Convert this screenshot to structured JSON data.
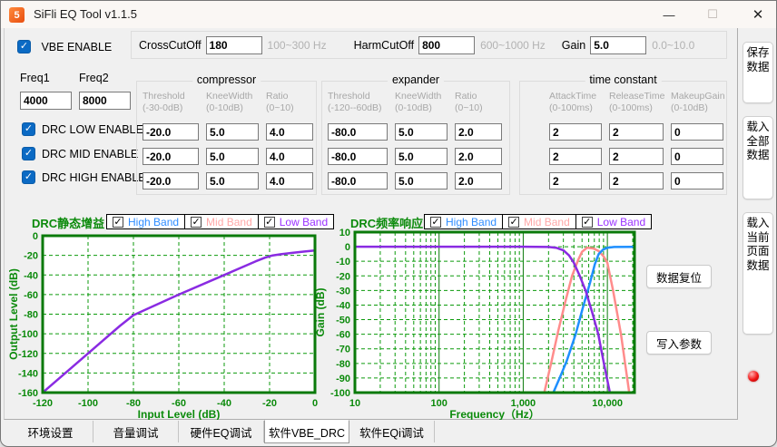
{
  "window": {
    "title": "SiFli EQ Tool v1.1.5",
    "minimize_glyph": "—",
    "maximize_glyph": "☐",
    "close_glyph": "✕",
    "logo_glyph": "5"
  },
  "vbe": {
    "enable_label": "VBE ENABLE",
    "enabled": true,
    "cross_cutoff": {
      "label": "CrossCutOff",
      "value": "180",
      "hint": "100~300 Hz"
    },
    "harm_cutoff": {
      "label": "HarmCutOff",
      "value": "800",
      "hint": "600~1000 Hz"
    },
    "gain": {
      "label": "Gain",
      "value": "5.0",
      "hint": "0.0~10.0"
    }
  },
  "freq": {
    "freq1_label": "Freq1",
    "freq1_value": "4000",
    "freq2_label": "Freq2",
    "freq2_value": "8000"
  },
  "drc": {
    "rows": [
      {
        "label": "DRC LOW ENABLE",
        "checked": true
      },
      {
        "label": "DRC MID ENABLE",
        "checked": true
      },
      {
        "label": "DRC HIGH ENABLE",
        "checked": true
      }
    ]
  },
  "groups": {
    "compressor": {
      "title": "compressor",
      "columns": [
        {
          "name": "Threshold",
          "range": "(-30-0dB)"
        },
        {
          "name": "KneeWidth",
          "range": "(0-10dB)"
        },
        {
          "name": "Ratio",
          "range": "(0~10)"
        }
      ],
      "rows": [
        [
          "-20.0",
          "5.0",
          "4.0"
        ],
        [
          "-20.0",
          "5.0",
          "4.0"
        ],
        [
          "-20.0",
          "5.0",
          "4.0"
        ]
      ]
    },
    "expander": {
      "title": "expander",
      "columns": [
        {
          "name": "Threshold",
          "range": "(-120--60dB)"
        },
        {
          "name": "KneeWidth",
          "range": "(0-10dB)"
        },
        {
          "name": "Ratio",
          "range": "(0~10)"
        }
      ],
      "rows": [
        [
          "-80.0",
          "5.0",
          "2.0"
        ],
        [
          "-80.0",
          "5.0",
          "2.0"
        ],
        [
          "-80.0",
          "5.0",
          "2.0"
        ]
      ]
    },
    "time_constant": {
      "title": "time constant",
      "columns": [
        {
          "name": "AttackTime",
          "range": "(0-100ms)"
        },
        {
          "name": "ReleaseTime",
          "range": "(0-100ms)"
        },
        {
          "name": "MakeupGain",
          "range": "(0-10dB)"
        }
      ],
      "rows": [
        [
          "2",
          "2",
          "0"
        ],
        [
          "2",
          "2",
          "0"
        ],
        [
          "2",
          "2",
          "0"
        ]
      ]
    }
  },
  "charts": {
    "legend": {
      "items": [
        {
          "label": "High Band",
          "color": "#2f8dff",
          "checked": true
        },
        {
          "label": "Mid Band",
          "color": "#ffa8a8",
          "checked": true
        },
        {
          "label": "Low Band",
          "color": "#9a30ff",
          "checked": true
        }
      ]
    },
    "accent_green": "#0b8a0b"
  },
  "chart_data": [
    {
      "type": "line",
      "id": "static_gain",
      "title": "DRC静态增益",
      "xlabel": "Input Level (dB)",
      "ylabel": "Output Level (dB)",
      "x_scale": "linear",
      "xlim": [
        -120,
        0
      ],
      "ylim": [
        -160,
        0
      ],
      "grid": true,
      "legend_position": "top",
      "x_ticks": [
        {
          "v": -120,
          "label": "-120"
        },
        {
          "v": -100,
          "label": "-100"
        },
        {
          "v": -80,
          "label": "-80"
        },
        {
          "v": -60,
          "label": "-60"
        },
        {
          "v": -40,
          "label": "-40"
        },
        {
          "v": -20,
          "label": "-20"
        },
        {
          "v": 0,
          "label": "0"
        }
      ],
      "y_ticks": [
        {
          "v": 0,
          "label": "0"
        },
        {
          "v": -20,
          "label": "-20"
        },
        {
          "v": -40,
          "label": "-40"
        },
        {
          "v": -60,
          "label": "-60"
        },
        {
          "v": -80,
          "label": "-80"
        },
        {
          "v": -100,
          "label": "-100"
        },
        {
          "v": -120,
          "label": "-120"
        },
        {
          "v": -140,
          "label": "-140"
        },
        {
          "v": -160,
          "label": "-160"
        }
      ],
      "series": [
        {
          "name": "all-bands-static-gain",
          "color": "#8a2be2",
          "points": [
            [
              -120,
              -160
            ],
            [
              -100,
              -120
            ],
            [
              -86,
              -92
            ],
            [
              -80,
              -81
            ],
            [
              -74,
              -74.6
            ],
            [
              -60,
              -60
            ],
            [
              -40,
              -40
            ],
            [
              -26,
              -26
            ],
            [
              -22,
              -22.4
            ],
            [
              -19,
              -20.3
            ],
            [
              -15,
              -18.9
            ],
            [
              -10,
              -17.5
            ],
            [
              -5,
              -16.2
            ],
            [
              0,
              -15
            ]
          ]
        }
      ]
    },
    {
      "type": "line",
      "id": "freq_response",
      "title": "DRC频率响应",
      "xlabel": "Frequency（Hz）",
      "ylabel": "Gain (dB)",
      "x_scale": "log",
      "xlim": [
        10,
        21000
      ],
      "ylim": [
        -100,
        10
      ],
      "grid": true,
      "legend_position": "top",
      "x_ticks": [
        {
          "v": 10,
          "label": "10"
        },
        {
          "v": 100,
          "label": "100"
        },
        {
          "v": 1000,
          "label": "1,000"
        },
        {
          "v": 10000,
          "label": "10,000"
        }
      ],
      "y_ticks": [
        {
          "v": 10,
          "label": "10"
        },
        {
          "v": 0,
          "label": "0"
        },
        {
          "v": -10,
          "label": "-10"
        },
        {
          "v": -20,
          "label": "-20"
        },
        {
          "v": -30,
          "label": "-30"
        },
        {
          "v": -40,
          "label": "-40"
        },
        {
          "v": -50,
          "label": "-50"
        },
        {
          "v": -60,
          "label": "-60"
        },
        {
          "v": -70,
          "label": "-70"
        },
        {
          "v": -80,
          "label": "-80"
        },
        {
          "v": -90,
          "label": "-90"
        },
        {
          "v": -100,
          "label": "-100"
        }
      ],
      "series": [
        {
          "name": "mid-band",
          "color": "#ff8c8c",
          "points": [
            [
              1780,
              -100
            ],
            [
              2140,
              -80
            ],
            [
              2600,
              -58
            ],
            [
              3160,
              -38
            ],
            [
              3800,
              -20
            ],
            [
              4500,
              -9
            ],
            [
              5000,
              -3.5
            ],
            [
              5750,
              -0.6
            ],
            [
              6800,
              -1.2
            ],
            [
              7900,
              -3
            ],
            [
              9000,
              -6.5
            ],
            [
              10000,
              -11
            ],
            [
              11700,
              -30
            ],
            [
              14500,
              -60
            ],
            [
              18200,
              -100
            ]
          ]
        },
        {
          "name": "high-band",
          "color": "#1e8fff",
          "points": [
            [
              2280,
              -100
            ],
            [
              2800,
              -88
            ],
            [
              3300,
              -78
            ],
            [
              4200,
              -60
            ],
            [
              5100,
              -42
            ],
            [
              6200,
              -25
            ],
            [
              7100,
              -12
            ],
            [
              7900,
              -5
            ],
            [
              8900,
              -2
            ],
            [
              10000,
              -0.7
            ],
            [
              12000,
              -0.2
            ],
            [
              21000,
              -0.1
            ]
          ]
        },
        {
          "name": "low-band",
          "color": "#8a2be2",
          "points": [
            [
              10,
              0
            ],
            [
              1000,
              0
            ],
            [
              2000,
              -0.2
            ],
            [
              2500,
              -0.8
            ],
            [
              3000,
              -2.5
            ],
            [
              3500,
              -6
            ],
            [
              4000,
              -11
            ],
            [
              4700,
              -20
            ],
            [
              5500,
              -30
            ],
            [
              6600,
              -45
            ],
            [
              7800,
              -60
            ],
            [
              9100,
              -80
            ],
            [
              10700,
              -100
            ]
          ]
        }
      ]
    }
  ],
  "buttons": {
    "reset": "数据复位",
    "write": "写入参数"
  },
  "side_buttons": [
    {
      "label": "保存数据"
    },
    {
      "label": "载入全部数据"
    },
    {
      "label": "载入当前页面数据"
    }
  ],
  "tabs": {
    "items": [
      "环境设置",
      "音量调试",
      "硬件EQ调试",
      "软件VBE_DRC",
      "软件EQi调试"
    ],
    "active": "软件VBE_DRC"
  },
  "status_led_color": "#f21414"
}
